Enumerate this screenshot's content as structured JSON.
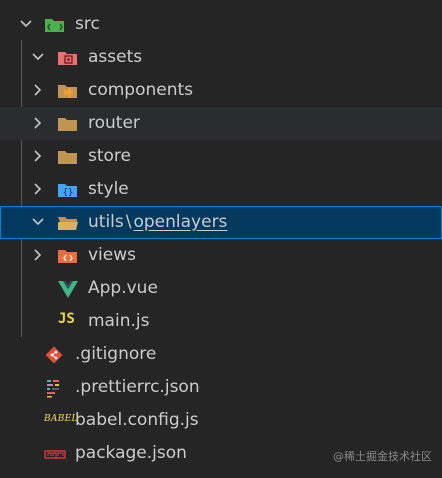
{
  "explorer": {
    "src": {
      "label": "src",
      "icon": "folder-src-open-icon"
    },
    "assets": {
      "label": "assets",
      "icon": "folder-assets-open-icon"
    },
    "components": {
      "label": "components",
      "icon": "folder-components-icon"
    },
    "router": {
      "label": "router",
      "icon": "folder-icon"
    },
    "store": {
      "label": "store",
      "icon": "folder-icon"
    },
    "style": {
      "label": "style",
      "icon": "folder-style-icon"
    },
    "utils": {
      "label": "utils",
      "separator": "\\",
      "sublabel": "openlayers",
      "icon": "folder-open-icon"
    },
    "views": {
      "label": "views",
      "icon": "folder-views-icon"
    },
    "app_vue": {
      "label": "App.vue",
      "icon": "vue-icon"
    },
    "main_js": {
      "label": "main.js",
      "badge": "JS",
      "icon": "javascript-icon"
    },
    "gitignore": {
      "label": ".gitignore",
      "icon": "git-icon"
    },
    "prettierrc": {
      "label": ".prettierrc.json",
      "icon": "prettier-icon"
    },
    "babel_config": {
      "label": "babel.config.js",
      "badge": "BABEL",
      "icon": "babel-icon"
    },
    "package_json": {
      "label": "package.json",
      "icon": "npm-icon"
    }
  },
  "watermark": "@稀土掘金技术社区",
  "colors": {
    "background": "#252526",
    "selected_background": "#04395e",
    "selected_border": "#007fd4",
    "hover_background": "#2a2d2e",
    "text": "#cccccc",
    "folder_tan": "#c09553",
    "vue_green": "#41b883",
    "js_yellow": "#e8d44d",
    "git_red": "#e44d37"
  }
}
